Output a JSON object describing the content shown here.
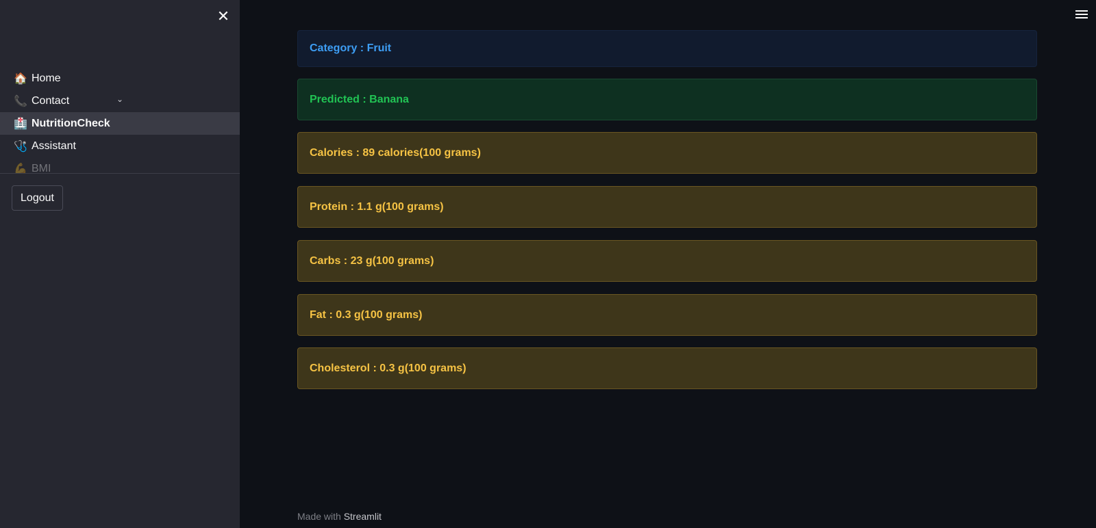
{
  "sidebar": {
    "nav_items": [
      {
        "icon": "🏠",
        "label": "Home"
      },
      {
        "icon": "📞",
        "label": "Contact"
      },
      {
        "icon": "🏥",
        "label": "NutritionCheck"
      },
      {
        "icon": "🩺",
        "label": "Assistant"
      },
      {
        "icon": "💪",
        "label": "BMI"
      }
    ],
    "active_index": 2,
    "logout_label": "Logout"
  },
  "main": {
    "category": "Category : Fruit",
    "predicted": "Predicted : Banana",
    "nutrients": [
      "Calories : 89 calories(100 grams)",
      "Protein : 1.1 g(100 grams)",
      "Carbs : 23 g(100 grams)",
      "Fat : 0.3 g(100 grams)",
      "Cholesterol : 0.3 g(100 grams)"
    ]
  },
  "footer": {
    "prefix": "Made with",
    "brand": "Streamlit"
  },
  "colors": {
    "info_text": "#3d9df3",
    "success_text": "#21c354",
    "warning_text": "#f6c344"
  }
}
